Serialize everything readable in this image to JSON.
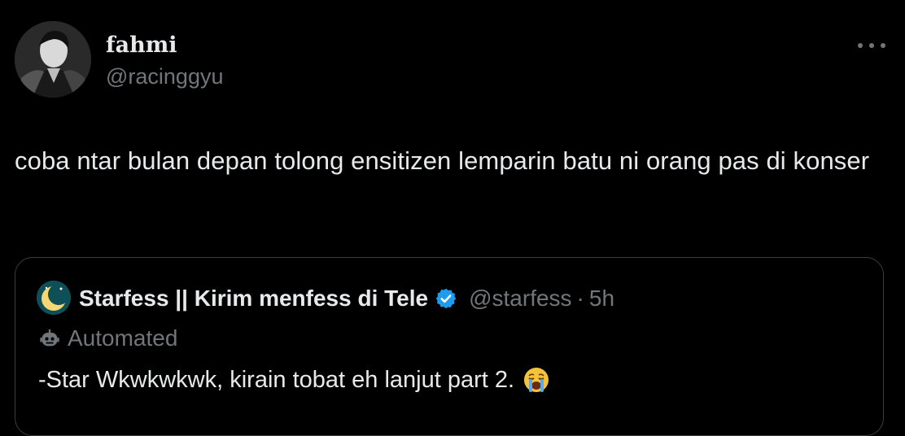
{
  "tweet": {
    "author_name": "fahmi",
    "author_handle": "@racinggyu",
    "avatar_icon": "user-avatar-photo",
    "more_icon": "more-horizontal-icon",
    "text": "coba ntar bulan depan tolong ensitizen lemparin batu ni orang pas di konser"
  },
  "quoted_tweet": {
    "author_name": "Starfess || Kirim menfess di Tele",
    "verified_icon": "verified-badge-icon",
    "author_handle": "@starfess",
    "separator": "·",
    "time": "5h",
    "automated_icon": "robot-icon",
    "automated_label": "Automated",
    "text": "-Star Wkwkwkwk, kirain tobat eh lanjut part 2.",
    "emoji_icon": "loudly-crying-face-emoji"
  },
  "colors": {
    "background": "#000000",
    "primary_text": "#e7e9ea",
    "secondary_text": "#71767b",
    "border": "#3a3d41",
    "verified_blue": "#1d9bf0"
  }
}
